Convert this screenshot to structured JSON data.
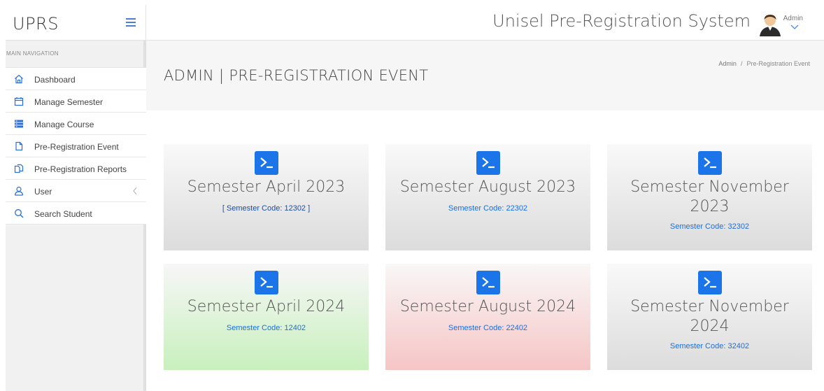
{
  "header": {
    "brand": "UPRS",
    "system_title": "Unisel Pre-Registration System",
    "user_name": "Admin"
  },
  "sidebar": {
    "heading": "MAIN NAVIGATION",
    "items": [
      {
        "label": "Dashboard",
        "icon": "home-icon"
      },
      {
        "label": "Manage Semester",
        "icon": "calendar-icon"
      },
      {
        "label": "Manage Course",
        "icon": "list-icon"
      },
      {
        "label": "Pre-Registration Event",
        "icon": "file-icon"
      },
      {
        "label": "Pre-Registration Reports",
        "icon": "files-icon"
      },
      {
        "label": "User",
        "icon": "user-icon"
      },
      {
        "label": "Search Student",
        "icon": "search-icon"
      }
    ]
  },
  "page": {
    "title": "ADMIN | PRE-REGISTRATION EVENT",
    "breadcrumb": [
      "Admin",
      "Pre-Registration Event"
    ]
  },
  "cards": [
    {
      "title": "Semester April 2023",
      "code": "[  Semester Code: 12302  ]",
      "color": "gray"
    },
    {
      "title": "Semester August 2023",
      "code": "Semester Code: 22302",
      "color": "gray"
    },
    {
      "title": "Semester November 2023",
      "code": "Semester Code: 32302",
      "color": "gray"
    },
    {
      "title": "Semester April 2024",
      "code": "Semester Code: 12402",
      "color": "green"
    },
    {
      "title": "Semester August 2024",
      "code": "Semester Code: 22402",
      "color": "red"
    },
    {
      "title": "Semester November 2024",
      "code": "Semester Code: 32402",
      "color": "gray"
    }
  ],
  "colors": {
    "accent": "#1b74e8",
    "link": "#1a6fe0",
    "card_green": "#c8f0bd",
    "card_red": "#f6c5c5"
  }
}
